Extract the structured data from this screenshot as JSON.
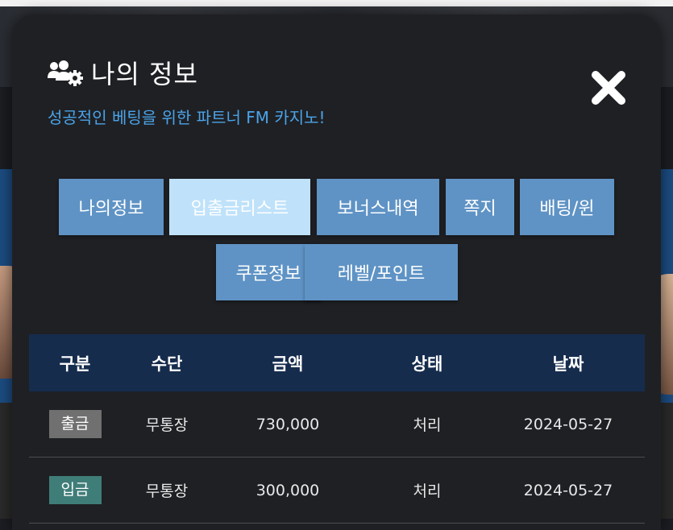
{
  "modal": {
    "title": "나의 정보",
    "subtitle": "성공적인 베팅을 위한 파트너 FM 카지노!",
    "title_icon": "users-gear-icon",
    "close_icon": "close-icon"
  },
  "tabs": [
    {
      "label": "나의정보",
      "active": false
    },
    {
      "label": "입출금리스트",
      "active": true
    },
    {
      "label": "보너스내역",
      "active": false
    },
    {
      "label": "쪽지",
      "active": false
    },
    {
      "label": "배팅/윈",
      "active": false
    },
    {
      "label": "쿠폰정보",
      "active": false
    },
    {
      "label": "레벨/포인트",
      "active": false
    }
  ],
  "table": {
    "headers": [
      "구분",
      "수단",
      "금액",
      "상태",
      "날짜"
    ],
    "rows": [
      {
        "type": "출금",
        "method": "무통장",
        "amount": "730,000",
        "status": "처리",
        "date": "2024-05-27"
      },
      {
        "type": "입금",
        "method": "무통장",
        "amount": "300,000",
        "status": "처리",
        "date": "2024-05-27"
      }
    ]
  },
  "colors": {
    "accent": "#4aa3e8",
    "tab": "#5f93c5",
    "tab_active": "#bfe2fa",
    "table_header": "#162c4d",
    "badge_out": "#707070",
    "badge_in": "#3f7d78"
  }
}
